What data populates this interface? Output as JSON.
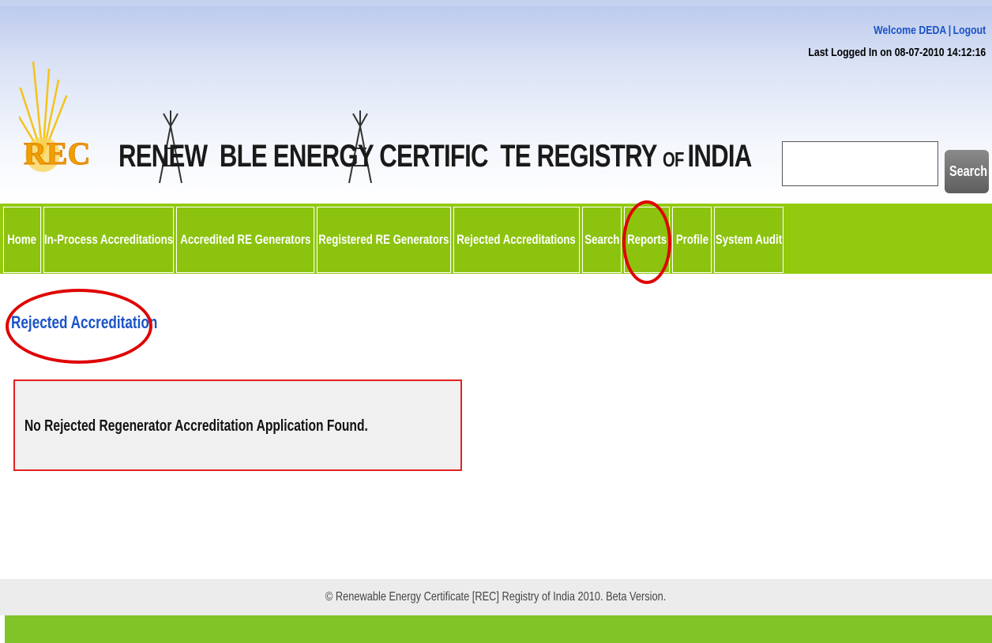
{
  "header": {
    "welcome_text": "Welcome DEDA",
    "logout_label": "Logout",
    "separator": "|",
    "last_logged_in": "Last Logged In on 08-07-2010 14:12:16",
    "logo_text": "REC",
    "title": {
      "part1": "RENEW",
      "part2": "BLE ENERGY CERTIFIC",
      "part3": "TE REGISTRY ",
      "part4": "OF ",
      "part5": "INDIA"
    }
  },
  "search": {
    "value": "",
    "button_label": "Search"
  },
  "nav": {
    "items": [
      {
        "label": "Home"
      },
      {
        "label": "In-Process Accreditations"
      },
      {
        "label": "Accredited RE Generators"
      },
      {
        "label": "Registered RE Generators"
      },
      {
        "label": "Rejected Accreditations"
      },
      {
        "label": "Search"
      },
      {
        "label": "Reports"
      },
      {
        "label": "Profile"
      },
      {
        "label": "System Audit"
      }
    ]
  },
  "main": {
    "section_title": "Rejected Accreditation",
    "message": "No Rejected Regenerator Accreditation Application Found."
  },
  "footer": {
    "copyright": "© Renewable Energy Certificate [REC] Registry of India 2010. Beta Version."
  },
  "colors": {
    "nav_green": "#93ca10",
    "link_blue": "#1a52c8",
    "highlight_red": "#e00000",
    "footer_green": "#80c428"
  }
}
